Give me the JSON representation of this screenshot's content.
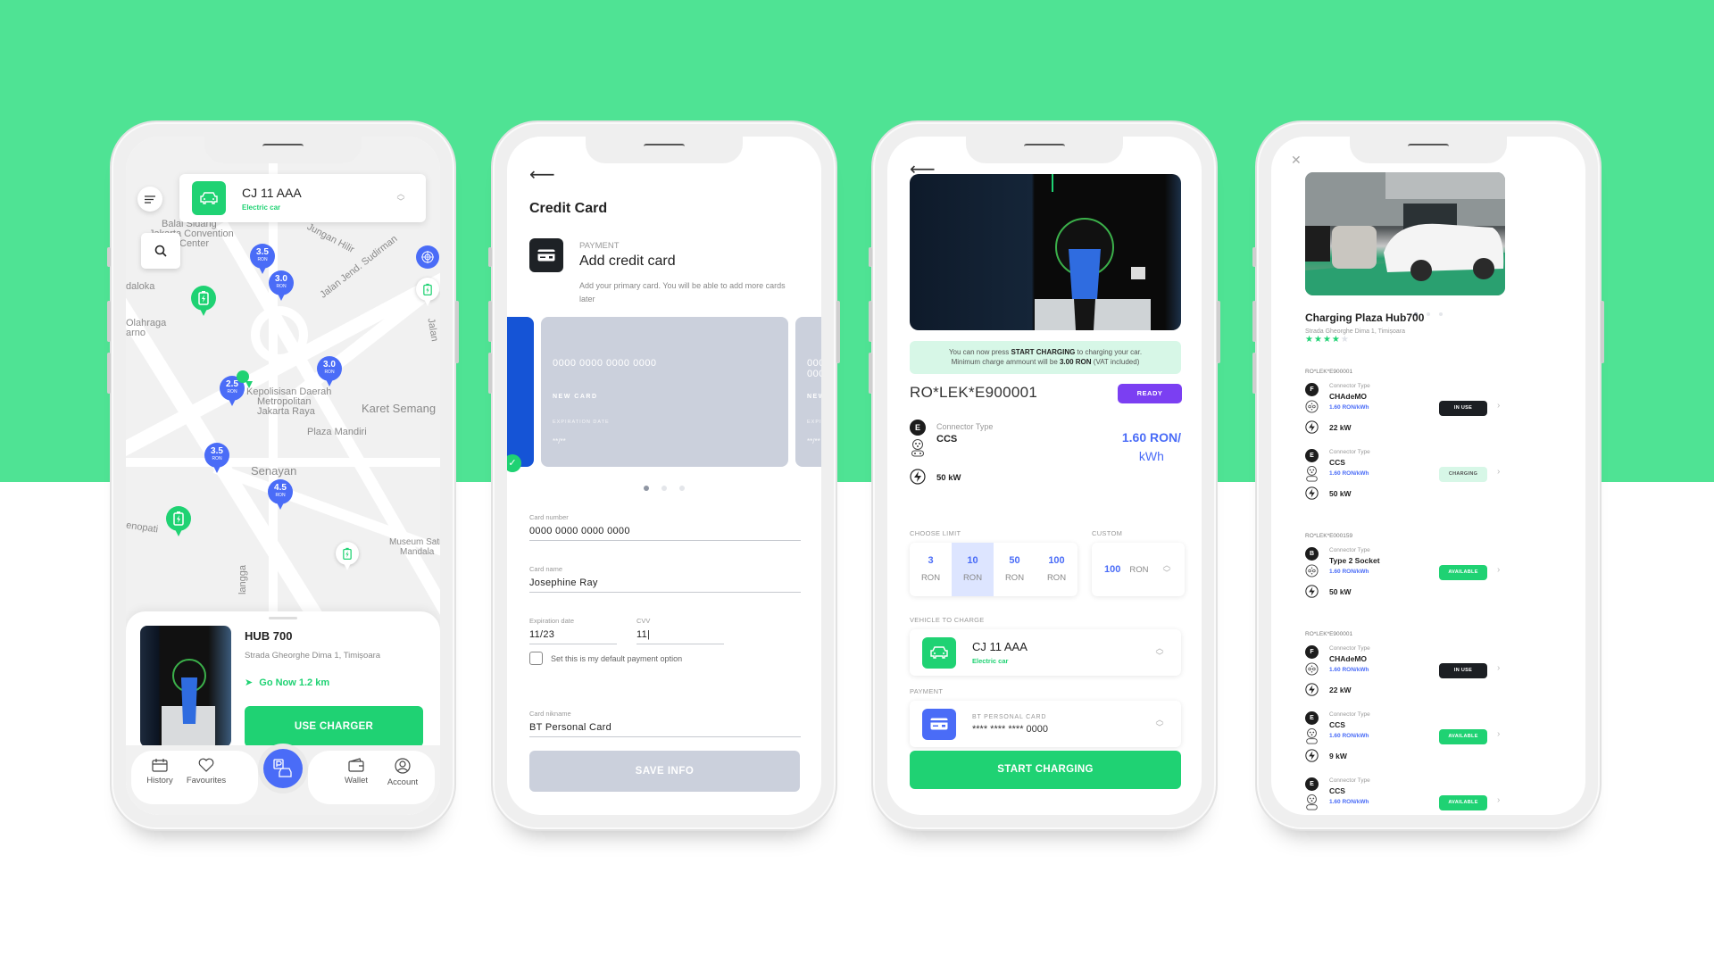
{
  "colors": {
    "background_green": "#4fe394",
    "accent_green": "#1fd273",
    "accent_blue": "#4a6cf7",
    "badge_purple": "#7b3ff2",
    "card_grey": "#cbd0dc",
    "card_blue": "#1554d6"
  },
  "map_screen": {
    "vehicle": {
      "plate": "CJ 11 AAA",
      "type": "Electric car"
    },
    "map_labels": [
      "Balai Sidang",
      "Jakarta Convention",
      "Center",
      "daloka",
      "Olahraga",
      "arno",
      "Jungan Hilir",
      "Jalan Jend. Sudirman",
      "Jalan",
      "Kepolisisan Daerah",
      "Metropolitan",
      "Jakarta Raya",
      "Karet Semang",
      "Plaza Mandiri",
      "Senayan",
      "enopati",
      "Museum Satria",
      "Mandala",
      "langga"
    ],
    "price_pins": [
      {
        "value": "3.5",
        "unit": "RON"
      },
      {
        "value": "3.0",
        "unit": "RON"
      },
      {
        "value": "3.0",
        "unit": "RON"
      },
      {
        "value": "2.5",
        "unit": "RON"
      },
      {
        "value": "3.5",
        "unit": "RON"
      },
      {
        "value": "4.5",
        "unit": "RON"
      }
    ],
    "hub": {
      "title": "HUB 700",
      "address": "Strada Gheorghe Dima 1, Timișoara",
      "go_now": "Go Now 1.2 km",
      "use_charger": "USE CHARGER"
    },
    "tabs": [
      {
        "label": "History",
        "icon": "calendar-icon"
      },
      {
        "label": "Favourites",
        "icon": "heart-icon"
      },
      {
        "label": "",
        "icon": "parking-car-icon"
      },
      {
        "label": "Wallet",
        "icon": "wallet-icon"
      },
      {
        "label": "Account",
        "icon": "account-icon"
      }
    ]
  },
  "credit_card_screen": {
    "title": "Credit Card",
    "section_kicker": "PAYMENT",
    "section_title": "Add credit card",
    "section_desc": "Add your primary card. You will be able to add more cards later",
    "card_preview": {
      "number": "0000 0000 0000 0000",
      "name": "NEW CARD",
      "expiration_label": "EXPIRATION DATE",
      "expiration": "**/**"
    },
    "carousel": {
      "count": 3,
      "active": 1
    },
    "fields": {
      "card_number": {
        "label": "Card number",
        "value": "0000 0000 0000 0000"
      },
      "card_name": {
        "label": "Card name",
        "value": "Josephine Ray"
      },
      "expiration": {
        "label": "Expiration date",
        "value": "11/23"
      },
      "cvv": {
        "label": "CVV",
        "value": "11|"
      },
      "nickname": {
        "label": "Card nikname",
        "value": "BT Personal Card"
      }
    },
    "default_checkbox": {
      "label": "Set this is my default payment option",
      "checked": false
    },
    "save_label": "SAVE INFO"
  },
  "charging_screen": {
    "banner_pre": "You can now press ",
    "banner_bold1": "START CHARGING",
    "banner_mid": " to charging your car.",
    "banner_line2_pre": "Minimum charge ammount will be ",
    "banner_bold2": "3.00 RON",
    "banner_line2_post": " (VAT included)",
    "station_id": "RO*LEK*E900001",
    "status": "READY",
    "connector": {
      "letter": "E",
      "label": "Connector Type",
      "type": "CCS",
      "power": "50 kW",
      "price_amount": "1.60 RON/",
      "price_unit": "kWh"
    },
    "choose_limit_label": "CHOOSE LIMIT",
    "limits": [
      {
        "value": "3",
        "unit": "RON",
        "selected": false
      },
      {
        "value": "10",
        "unit": "RON",
        "selected": true
      },
      {
        "value": "50",
        "unit": "RON",
        "selected": false
      },
      {
        "value": "100",
        "unit": "RON",
        "selected": false
      }
    ],
    "custom_label": "CUSTOM",
    "custom": {
      "value": "100",
      "unit": "RON"
    },
    "vehicle_label": "VEHICLE TO CHARGE",
    "vehicle": {
      "plate": "CJ 11 AAA",
      "type": "Electric car"
    },
    "payment_label": "PAYMENT",
    "payment": {
      "name": "BT PERSONAL CARD",
      "masked": "**** **** **** 0000"
    },
    "start_label": "START CHARGING"
  },
  "station_screen": {
    "title": "Charging Plaza Hub700",
    "address": "Strada Gheorghe Dima 1, Timișoara",
    "rating": 4,
    "rating_max": 5,
    "photo_carousel": {
      "count": 3,
      "active": 1
    },
    "groups": [
      {
        "id": "RO*LEK*E900001",
        "connectors": [
          {
            "letter": "F",
            "label": "Connector Type",
            "type": "CHAdeMO",
            "price": "1.60 RON/kWh",
            "power": "22 kW",
            "status": "IN USE",
            "status_kind": "inuse"
          },
          {
            "letter": "E",
            "label": "Connector Type",
            "type": "CCS",
            "price": "1.60 RON/kWh",
            "power": "50 kW",
            "status": "CHARGING",
            "status_kind": "charging"
          }
        ]
      },
      {
        "id": "RO*LEK*E000159",
        "connectors": [
          {
            "letter": "B",
            "label": "Connector Type",
            "type": "Type 2 Socket",
            "price": "1.60 RON/kWh",
            "power": "50 kW",
            "status": "AVAILABLE",
            "status_kind": "available"
          }
        ]
      },
      {
        "id": "RO*LEK*E900001",
        "connectors": [
          {
            "letter": "F",
            "label": "Connector Type",
            "type": "CHAdeMO",
            "price": "1.60 RON/kWh",
            "power": "22 kW",
            "status": "IN USE",
            "status_kind": "inuse"
          },
          {
            "letter": "E",
            "label": "Connector Type",
            "type": "CCS",
            "price": "1.60 RON/kWh",
            "power": "9 kW",
            "status": "AVAILABLE",
            "status_kind": "available"
          },
          {
            "letter": "E",
            "label": "Connector Type",
            "type": "CCS",
            "price": "1.60 RON/kWh",
            "power": "",
            "status": "AVAILABLE",
            "status_kind": "available"
          }
        ]
      }
    ]
  }
}
